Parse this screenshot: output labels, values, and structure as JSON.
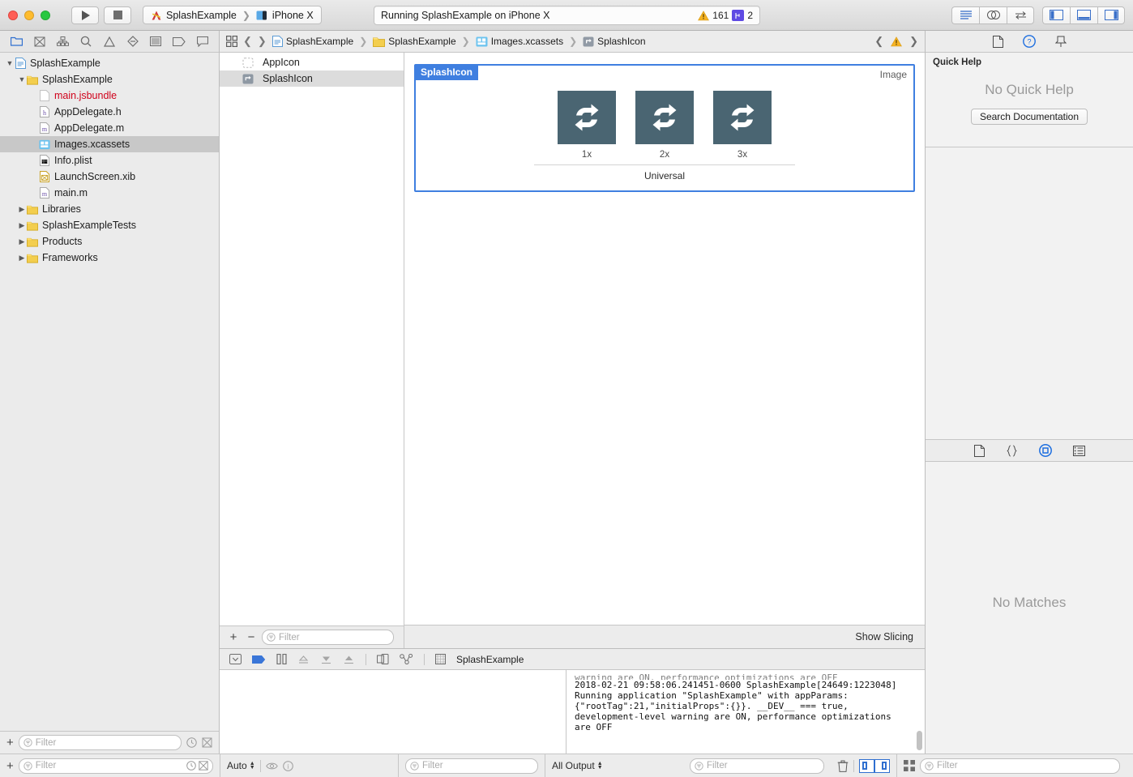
{
  "toolbar": {
    "run_icon": "play-icon",
    "stop_icon": "stop-icon",
    "scheme": {
      "project": "SplashExample",
      "destination": "iPhone X",
      "project_icon": "xcode-project-icon",
      "destination_icon": "simulator-icon"
    },
    "status": {
      "message": "Running SplashExample on iPhone X",
      "warning_count": "161",
      "warning_icon": "warning-triangle-icon",
      "source_control_icon": "branch-icon",
      "source_control_count": "2"
    },
    "view_buttons": [
      {
        "name": "standard-editor-button",
        "icon": "lines-icon"
      },
      {
        "name": "assistant-editor-button",
        "icon": "venn-circles-icon"
      },
      {
        "name": "version-editor-button",
        "icon": "arrows-swap-icon"
      }
    ],
    "panel_buttons": [
      {
        "name": "toggle-navigator-button",
        "icon": "left-panel-icon"
      },
      {
        "name": "toggle-debug-area-button",
        "icon": "bottom-panel-icon"
      },
      {
        "name": "toggle-utilities-button",
        "icon": "right-panel-icon"
      }
    ]
  },
  "navigator": {
    "tabs": [
      {
        "name": "project-navigator-tab",
        "icon": "folder-icon",
        "active": true
      },
      {
        "name": "source-control-navigator-tab",
        "icon": "source-control-icon",
        "active": false
      },
      {
        "name": "symbol-navigator-tab",
        "icon": "hierarchy-icon",
        "active": false
      },
      {
        "name": "find-navigator-tab",
        "icon": "search-icon",
        "active": false
      },
      {
        "name": "issue-navigator-tab",
        "icon": "warning-triangle-icon",
        "active": false
      },
      {
        "name": "test-navigator-tab",
        "icon": "diamond-icon",
        "active": false
      },
      {
        "name": "debug-navigator-tab",
        "icon": "debug-gauge-icon",
        "active": false
      },
      {
        "name": "breakpoint-navigator-tab",
        "icon": "breakpoint-tag-icon",
        "active": false
      },
      {
        "name": "report-navigator-tab",
        "icon": "speech-bubble-icon",
        "active": false
      }
    ],
    "tree": [
      {
        "label": "SplashExample",
        "indent": 0,
        "twisty": "down",
        "icon": "project-icon",
        "selected": false,
        "color": "normal"
      },
      {
        "label": "SplashExample",
        "indent": 1,
        "twisty": "down",
        "icon": "folder-icon",
        "selected": false,
        "color": "normal"
      },
      {
        "label": "main.jsbundle",
        "indent": 2,
        "twisty": "none",
        "icon": "file-plain-icon",
        "selected": false,
        "color": "red"
      },
      {
        "label": "AppDelegate.h",
        "indent": 2,
        "twisty": "none",
        "icon": "header-file-icon",
        "selected": false,
        "color": "normal"
      },
      {
        "label": "AppDelegate.m",
        "indent": 2,
        "twisty": "none",
        "icon": "objc-file-icon",
        "selected": false,
        "color": "normal"
      },
      {
        "label": "Images.xcassets",
        "indent": 2,
        "twisty": "none",
        "icon": "assets-icon",
        "selected": true,
        "color": "normal"
      },
      {
        "label": "Info.plist",
        "indent": 2,
        "twisty": "none",
        "icon": "plist-file-icon",
        "selected": false,
        "color": "normal"
      },
      {
        "label": "LaunchScreen.xib",
        "indent": 2,
        "twisty": "none",
        "icon": "xib-file-icon",
        "selected": false,
        "color": "normal"
      },
      {
        "label": "main.m",
        "indent": 2,
        "twisty": "none",
        "icon": "objc-file-icon",
        "selected": false,
        "color": "normal"
      },
      {
        "label": "Libraries",
        "indent": 1,
        "twisty": "right",
        "icon": "folder-icon",
        "selected": false,
        "color": "normal"
      },
      {
        "label": "SplashExampleTests",
        "indent": 1,
        "twisty": "right",
        "icon": "folder-icon",
        "selected": false,
        "color": "normal"
      },
      {
        "label": "Products",
        "indent": 1,
        "twisty": "right",
        "icon": "folder-icon",
        "selected": false,
        "color": "normal"
      },
      {
        "label": "Frameworks",
        "indent": 1,
        "twisty": "right",
        "icon": "folder-icon",
        "selected": false,
        "color": "normal"
      }
    ],
    "footer": {
      "add_label": "+",
      "filter_placeholder": "Filter",
      "filter_value": ""
    }
  },
  "jumpbar": {
    "grid_icon": "related-items-icon",
    "back_icon": "chevron-left-icon",
    "forward_icon": "chevron-right-icon",
    "crumbs": [
      {
        "label": "SplashExample",
        "icon": "project-icon"
      },
      {
        "label": "SplashExample",
        "icon": "folder-icon"
      },
      {
        "label": "Images.xcassets",
        "icon": "assets-icon"
      },
      {
        "label": "SplashIcon",
        "icon": "imageset-icon"
      }
    ],
    "prev_issue_icon": "chevron-left-icon",
    "issue_icon": "warning-triangle-icon",
    "next_issue_icon": "chevron-right-icon"
  },
  "asset_catalog": {
    "items": [
      {
        "label": "AppIcon",
        "icon": "appicon-placeholder-icon",
        "selected": false
      },
      {
        "label": "SplashIcon",
        "icon": "imageset-icon",
        "selected": true
      }
    ],
    "footer": {
      "add_label": "+",
      "remove_label": "−",
      "filter_placeholder": "Filter",
      "filter_value": ""
    }
  },
  "imageset_editor": {
    "title": "SplashIcon",
    "kind": "Image",
    "slots": [
      {
        "scale": "1x",
        "icon": "repeat-arrows-icon",
        "bg": "#4a6572",
        "filled": true
      },
      {
        "scale": "2x",
        "icon": "repeat-arrows-icon",
        "bg": "#4a6572",
        "filled": true
      },
      {
        "scale": "3x",
        "icon": "repeat-arrows-icon",
        "bg": "#4a6572",
        "filled": true
      }
    ],
    "device_label": "Universal",
    "slicing_button": "Show Slicing"
  },
  "debug_area": {
    "toolbar": [
      {
        "name": "hide-debug-bar-button",
        "icon": "disclosure-box-icon"
      },
      {
        "name": "deactivate-breakpoints-button",
        "icon": "breakpoint-flag-icon"
      },
      {
        "name": "pause-button",
        "icon": "pause-icon"
      },
      {
        "name": "step-over-button",
        "icon": "step-over-icon"
      },
      {
        "name": "step-into-button",
        "icon": "step-into-icon"
      },
      {
        "name": "step-out-button",
        "icon": "step-out-icon"
      },
      {
        "name": "view-debugging-button",
        "icon": "view-hierarchy-icon"
      },
      {
        "name": "memory-graph-button",
        "icon": "memory-graph-icon"
      },
      {
        "name": "process-icon",
        "icon": "grid-process-icon"
      }
    ],
    "process_label": "SplashExample",
    "console_lines": [
      "warning are ON, performance optimizations are OFF",
      "2018-02-21 09:58:06.241451-0600 SplashExample[24649:1223048]",
      "Running application \"SplashExample\" with appParams:",
      "{\"rootTag\":21,\"initialProps\":{}}. __DEV__ === true,",
      "development-level warning are ON, performance optimizations",
      "are OFF"
    ]
  },
  "utilities": {
    "inspector_tabs": [
      {
        "name": "file-inspector-tab",
        "icon": "document-icon",
        "active": false
      },
      {
        "name": "quick-help-inspector-tab",
        "icon": "question-circle-icon",
        "active": true
      },
      {
        "name": "pin-inspector-tab",
        "icon": "pin-icon",
        "active": false
      }
    ],
    "quick_help": {
      "header": "Quick Help",
      "empty_message": "No Quick Help",
      "search_button": "Search Documentation"
    },
    "library_tabs": [
      {
        "name": "file-template-library-tab",
        "icon": "document-icon",
        "active": false
      },
      {
        "name": "code-snippet-library-tab",
        "icon": "braces-icon",
        "active": false
      },
      {
        "name": "object-library-tab",
        "icon": "circle-square-icon",
        "active": true
      },
      {
        "name": "media-library-tab",
        "icon": "media-icon",
        "active": false
      }
    ],
    "library": {
      "empty_message": "No Matches"
    }
  },
  "status_bar": {
    "left": {
      "add_label": "+",
      "filter_placeholder": "Filter",
      "filter_value": "",
      "recent_icon": "clock-icon",
      "source-control_icon": "source-control-icon"
    },
    "variables": {
      "scope_label": "Auto",
      "eye_icon": "eye-icon",
      "info_icon": "info-circle-icon",
      "filter_placeholder": "Filter",
      "filter_value": ""
    },
    "console": {
      "output_label": "All Output",
      "filter_placeholder": "Filter",
      "filter_value": "",
      "trash_icon": "trash-icon",
      "split_left_icon": "variables-view-icon",
      "split_right_icon": "console-view-icon"
    },
    "library_filter": {
      "grid_icon": "grid-view-icon",
      "filter_placeholder": "Filter",
      "filter_value": ""
    }
  },
  "colors": {
    "accent_blue": "#3f7fe0",
    "selection_blue": "#2f6fd0",
    "slot_bg": "#4a6572",
    "warning_yellow": "#f5b323",
    "error_red": "#d0021b",
    "branch_purple": "#5e4ae3"
  }
}
